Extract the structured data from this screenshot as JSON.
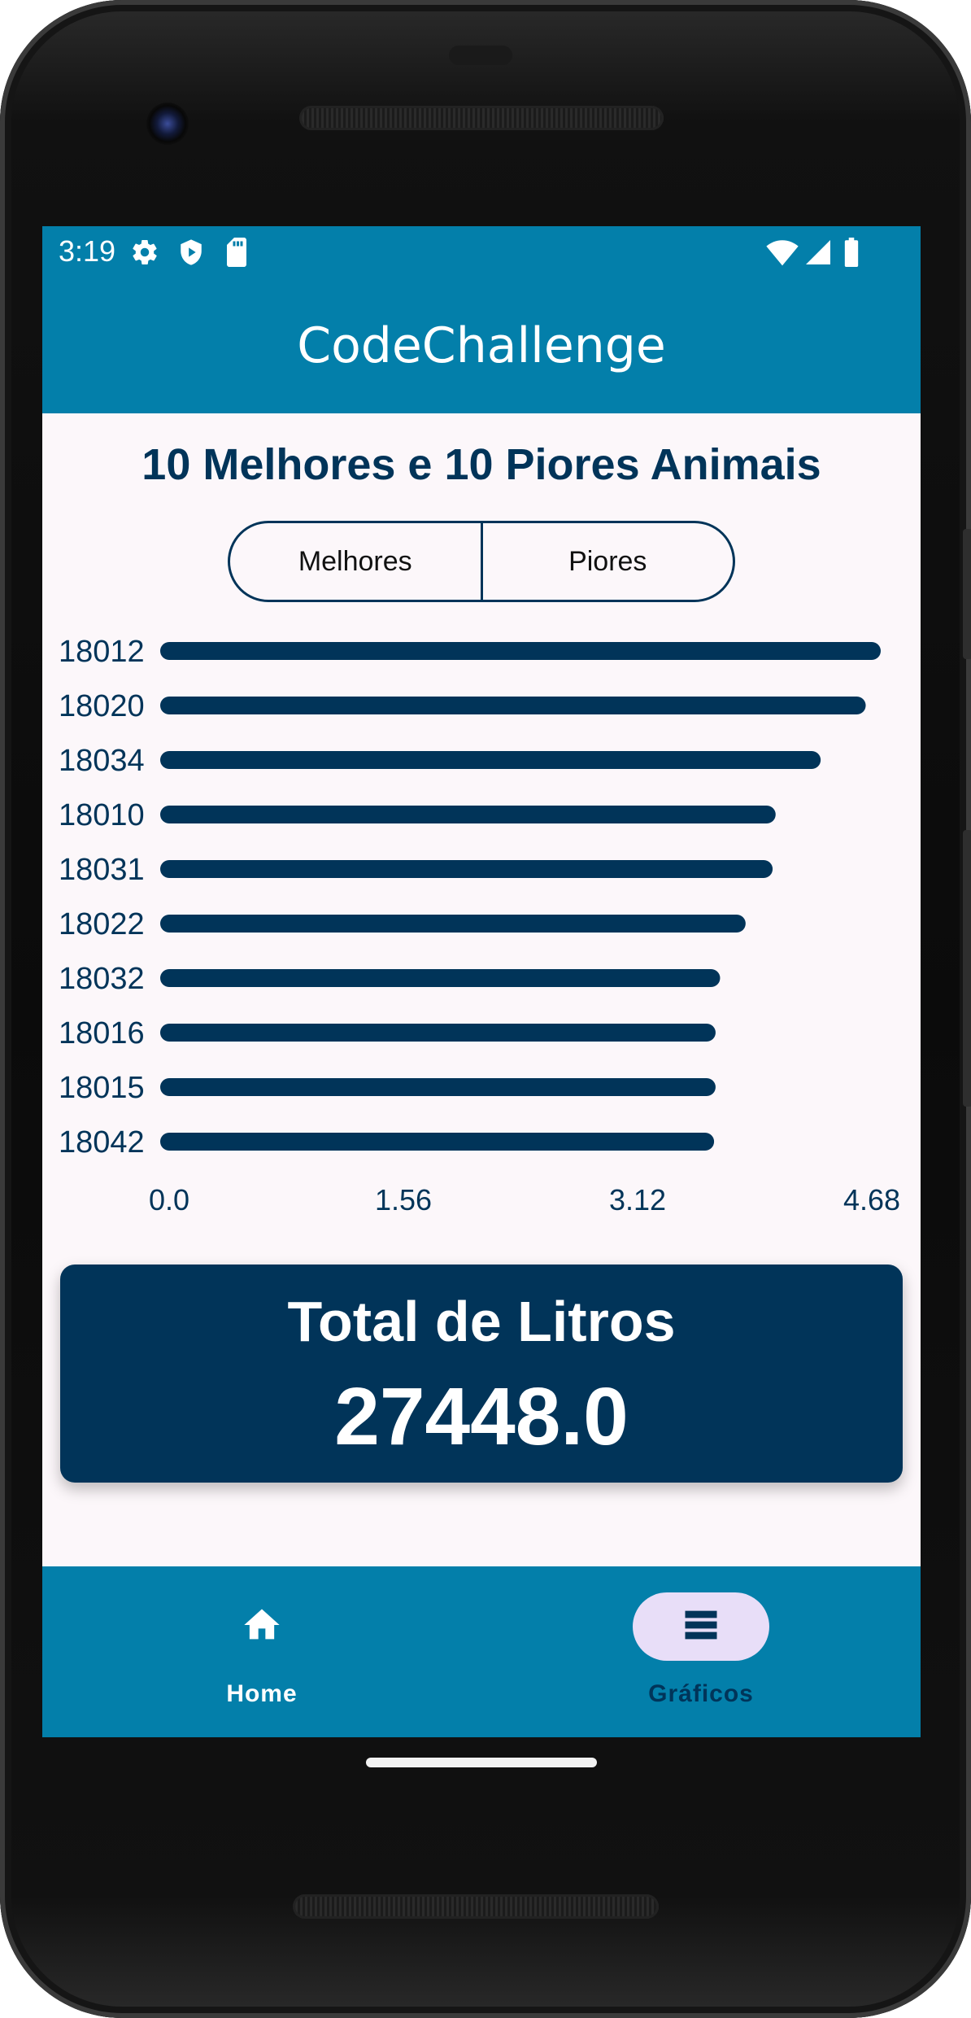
{
  "statusbar": {
    "time": "3:19"
  },
  "appbar": {
    "title": "CodeChallenge"
  },
  "page": {
    "title": "10 Melhores e 10 Piores Animais",
    "segments": [
      {
        "label": "Melhores"
      },
      {
        "label": "Piores"
      }
    ]
  },
  "chart_data": {
    "type": "bar",
    "orientation": "horizontal",
    "categories": [
      "18012",
      "18020",
      "18034",
      "18010",
      "18031",
      "18022",
      "18032",
      "18016",
      "18015",
      "18042"
    ],
    "values": [
      4.68,
      4.58,
      4.28,
      3.98,
      3.96,
      3.78,
      3.61,
      3.58,
      3.58,
      3.57
    ],
    "xlim": [
      0,
      4.68
    ],
    "xticks": [
      "0.0",
      "1.56",
      "3.12",
      "4.68"
    ],
    "bar_color": "#013459",
    "grid": false
  },
  "total": {
    "label": "Total de Litros",
    "value": "27448.0"
  },
  "bottom_nav": {
    "items": [
      {
        "label": "Home",
        "icon": "home-icon",
        "selected": false
      },
      {
        "label": "Gráficos",
        "icon": "list-icon",
        "selected": true
      }
    ]
  },
  "colors": {
    "primary": "#037faa",
    "dark": "#013459",
    "background": "#fcf7fa",
    "pill": "#e8def8"
  }
}
